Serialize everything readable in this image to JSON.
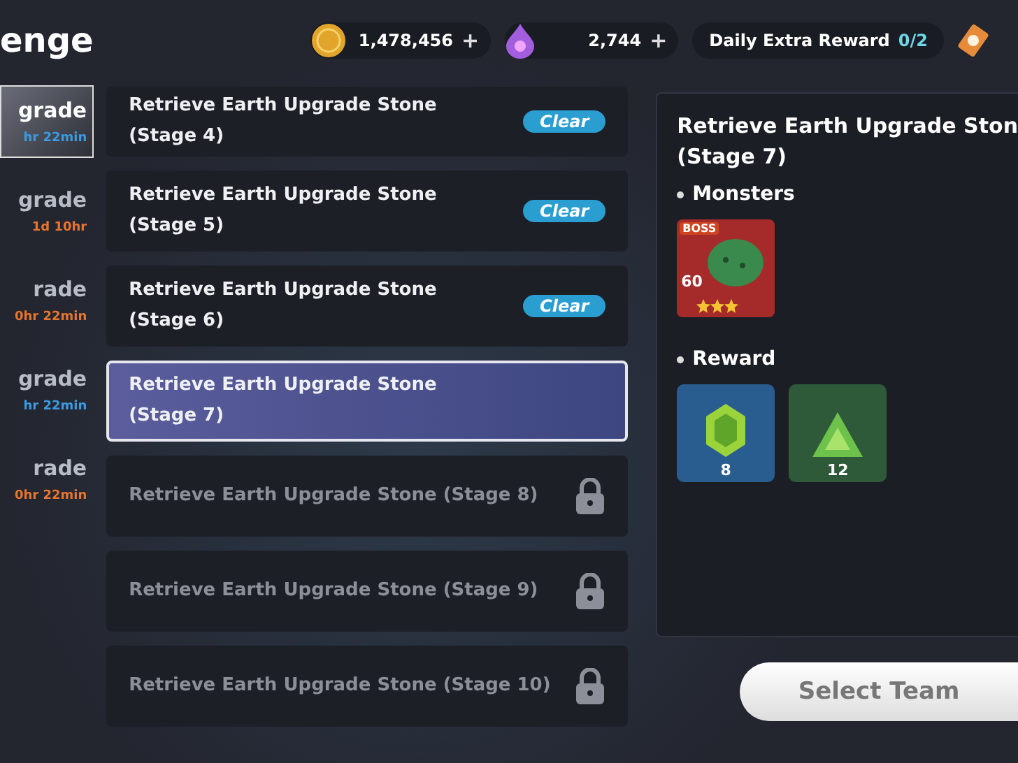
{
  "header": {
    "title": "enge",
    "currencies": [
      {
        "kind": "coin",
        "amount": "1,478,456",
        "plus": "+"
      },
      {
        "kind": "gem",
        "amount": "2,744",
        "plus": "+"
      }
    ],
    "daily": {
      "label": "Daily Extra Reward",
      "count": "0/2"
    }
  },
  "sidebar": [
    {
      "label": "grade",
      "timer": "hr 22min",
      "color": "#3b9be0",
      "selected": true
    },
    {
      "label": "grade",
      "timer": "1d 10hr",
      "color": "#e8752e",
      "selected": false
    },
    {
      "label": "rade",
      "timer": "0hr 22min",
      "color": "#e8752e",
      "selected": false
    },
    {
      "label": "grade",
      "timer": "hr 22min",
      "color": "#3b9be0",
      "selected": false
    },
    {
      "label": "rade",
      "timer": "0hr 22min",
      "color": "#e8752e",
      "selected": false
    }
  ],
  "stages": [
    {
      "title": "Retrieve Earth Upgrade Stone\n(Stage 4)",
      "badge": "Clear",
      "locked": false,
      "selected": false
    },
    {
      "title": "Retrieve Earth Upgrade Stone\n(Stage 5)",
      "badge": "Clear",
      "locked": false,
      "selected": false
    },
    {
      "title": "Retrieve Earth Upgrade Stone\n(Stage 6)",
      "badge": "Clear",
      "locked": false,
      "selected": false
    },
    {
      "title": "Retrieve Earth Upgrade Stone\n(Stage 7)",
      "locked": false,
      "selected": true
    },
    {
      "title": "Retrieve Earth Upgrade Stone (Stage 8)",
      "locked": true,
      "selected": false
    },
    {
      "title": "Retrieve Earth Upgrade Stone (Stage 9)",
      "locked": true,
      "selected": false
    },
    {
      "title": "Retrieve Earth Upgrade Stone (Stage 10)",
      "locked": true,
      "selected": false
    }
  ],
  "detail": {
    "title": "Retrieve Earth Upgrade Ston\n(Stage 7)",
    "monsters_label": "Monsters",
    "monsters": [
      {
        "badge": "BOSS",
        "level": "60",
        "stars": 3
      }
    ],
    "reward_label": "Reward",
    "rewards": [
      {
        "kind": "hex",
        "count": "8",
        "color": "#2a5d8f"
      },
      {
        "kind": "triangle",
        "count": "12",
        "color": "#2f5a3a"
      }
    ]
  },
  "select_button": "Select Team"
}
